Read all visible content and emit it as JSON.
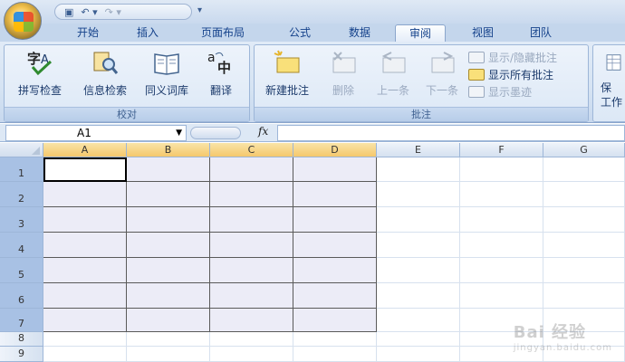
{
  "quick_access": {
    "save_icon": "save-icon",
    "undo_icon": "undo-icon",
    "redo_icon": "redo-icon"
  },
  "tabs": [
    {
      "label": "开始"
    },
    {
      "label": "插入"
    },
    {
      "label": "页面布局"
    },
    {
      "label": "公式"
    },
    {
      "label": "数据"
    },
    {
      "label": "审阅",
      "active": true
    },
    {
      "label": "视图"
    },
    {
      "label": "团队"
    }
  ],
  "ribbon": {
    "proofing": {
      "label": "校对",
      "buttons": [
        {
          "label": "拼写检查",
          "icon": "spellcheck-icon"
        },
        {
          "label": "信息检索",
          "icon": "research-icon"
        },
        {
          "label": "同义词库",
          "icon": "thesaurus-icon"
        },
        {
          "label": "翻译",
          "icon": "translate-icon"
        }
      ]
    },
    "comments": {
      "label": "批注",
      "buttons": [
        {
          "label": "新建批注",
          "icon": "new-comment-icon",
          "enabled": true
        },
        {
          "label": "删除",
          "icon": "delete-comment-icon",
          "enabled": false
        },
        {
          "label": "上一条",
          "icon": "previous-comment-icon",
          "enabled": false
        },
        {
          "label": "下一条",
          "icon": "next-comment-icon",
          "enabled": false
        }
      ],
      "small_buttons": [
        {
          "label": "显示/隐藏批注",
          "enabled": false
        },
        {
          "label": "显示所有批注",
          "enabled": true
        },
        {
          "label": "显示墨迹",
          "enabled": false
        }
      ]
    },
    "protect_partial": {
      "label_line1": "保",
      "label_line2": "工作"
    }
  },
  "formula_bar": {
    "name_box": "A1",
    "fx_label": "fx",
    "formula": ""
  },
  "grid": {
    "columns": [
      "A",
      "B",
      "C",
      "D",
      "E",
      "F",
      "G"
    ],
    "rows": [
      "1",
      "2",
      "3",
      "4",
      "5",
      "6",
      "7",
      "8",
      "9"
    ],
    "active_cell": "A1"
  },
  "watermark": {
    "text": "Bai 经验",
    "subtext": "jingyan.baidu.com"
  }
}
